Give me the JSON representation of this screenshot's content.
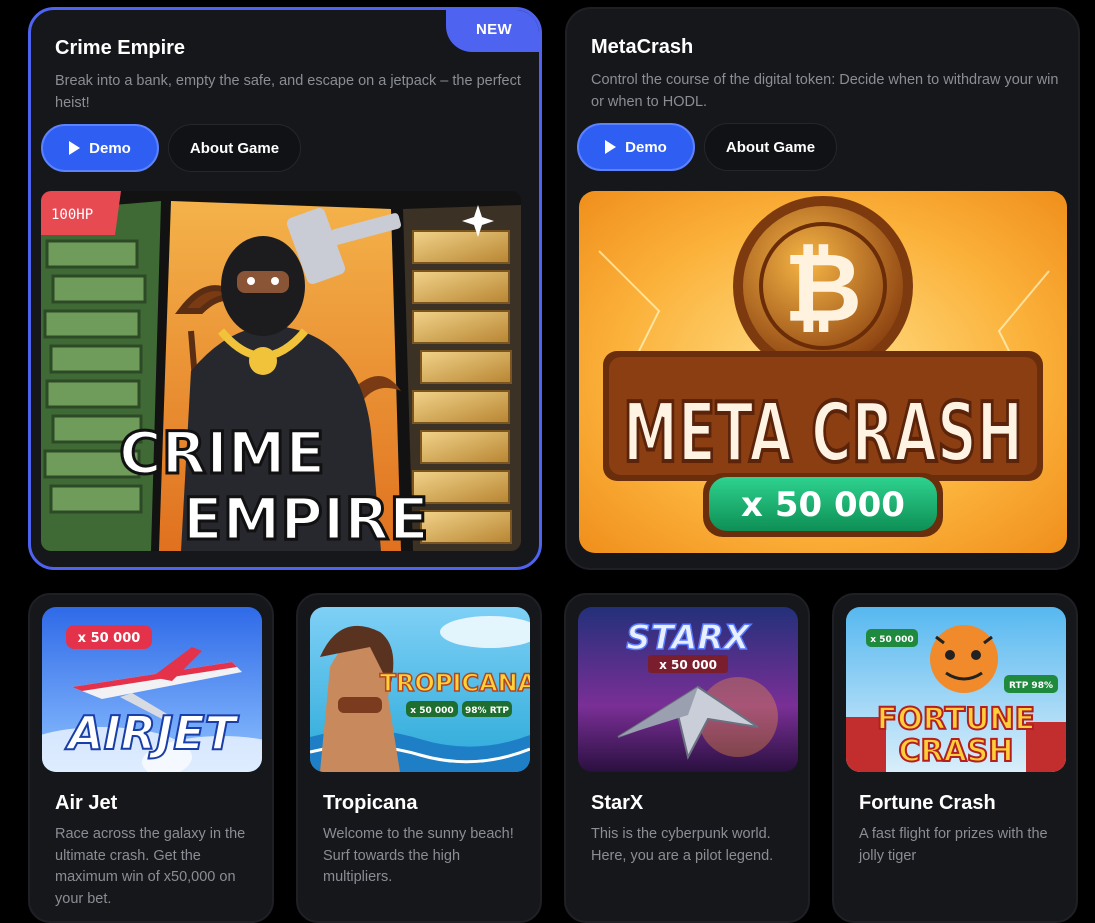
{
  "featured": [
    {
      "title": "Crime Empire",
      "description": "Break into a bank, empty the safe, and escape on a jetpack – the perfect heist!",
      "badge": "NEW",
      "demo_label": "Demo",
      "about_label": "About Game",
      "art": {
        "logo_line1": "CRIME",
        "logo_line2": "EMPIRE",
        "hp_badge": "100HP"
      }
    },
    {
      "title": "MetaCrash",
      "description": "Control the course of the digital token: Decide when to withdraw your win or when to HODL.",
      "demo_label": "Demo",
      "about_label": "About Game",
      "art": {
        "logo": "META CRASH",
        "multiplier": "x 50 000",
        "coin_symbol": "₿"
      }
    }
  ],
  "games": [
    {
      "title": "Air Jet",
      "description": "Race across the galaxy in the ultimate crash. Get the maximum win of x50,000 on your bet.",
      "art": {
        "logo": "AIRJET",
        "multiplier": "x 50 000"
      }
    },
    {
      "title": "Tropicana",
      "description": "Welcome to the sunny beach! Surf towards the high multipliers.",
      "art": {
        "logo": "TROPICANA",
        "multiplier": "x 50 000",
        "rtp": "98% RTP"
      }
    },
    {
      "title": "StarX",
      "description": "This is the cyberpunk world. Here, you are a pilot legend.",
      "art": {
        "logo": "STARX",
        "multiplier": "x 50 000"
      }
    },
    {
      "title": "Fortune Crash",
      "description": "A fast flight for prizes with the jolly tiger",
      "art": {
        "logo_line1": "FORTUNE",
        "logo_line2": "CRASH",
        "multiplier": "x 50 000",
        "rtp": "RTP 98%"
      }
    }
  ],
  "colors": {
    "accent": "#4e63f0",
    "demo_button": "#2f5ff2",
    "card_bg": "#16171b",
    "muted_text": "#8b8d95"
  }
}
